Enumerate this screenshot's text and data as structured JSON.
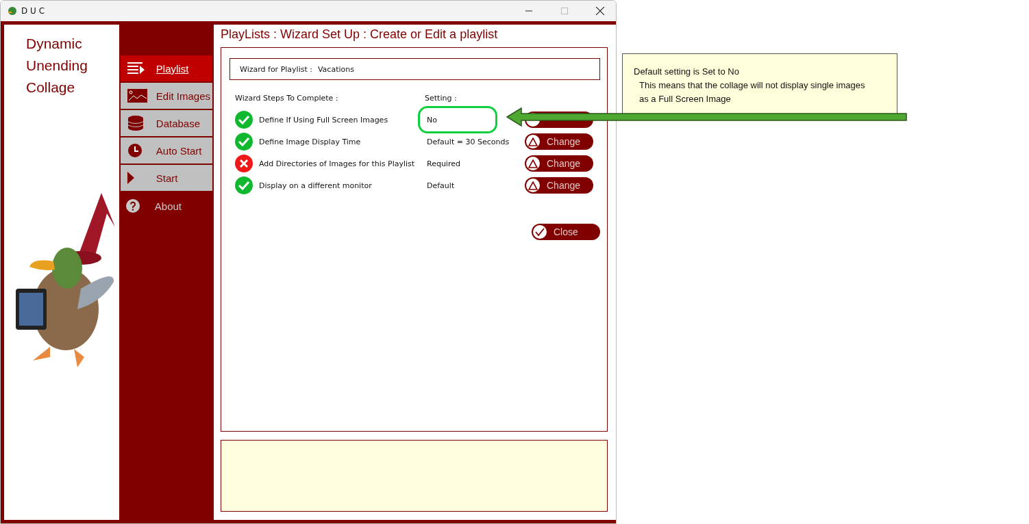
{
  "window": {
    "title": "D U C"
  },
  "brand": [
    "Dynamic",
    "Unending",
    "Collage"
  ],
  "nav": [
    {
      "label": "Playlist",
      "kind": "boxed",
      "selected": true
    },
    {
      "label": "Edit Images",
      "kind": "boxed",
      "selected": false
    },
    {
      "label": "Database",
      "kind": "boxed",
      "selected": false
    },
    {
      "label": "Auto Start",
      "kind": "boxed",
      "selected": false
    },
    {
      "label": "Start",
      "kind": "boxed",
      "selected": false
    },
    {
      "label": "About",
      "kind": "plain",
      "selected": false
    }
  ],
  "page_title": "PlayLists : Wizard Set Up : Create or Edit a playlist",
  "playlist_field": {
    "label": "Wizard for Playlist :",
    "value": "Vacations"
  },
  "steps_heading": "Wizard Steps To Complete :",
  "setting_heading": "Setting :",
  "steps": [
    {
      "label": "Define If Using Full Screen Images",
      "setting": "No",
      "done": true,
      "highlighted": true
    },
    {
      "label": "Define Image Display Time",
      "setting": "Default = 30 Seconds",
      "done": true,
      "highlighted": false,
      "button": "Change"
    },
    {
      "label": "Add Directories of Images for this Playlist",
      "setting": "Required",
      "done": false,
      "highlighted": false,
      "button": "Change"
    },
    {
      "label": "Display on a different monitor",
      "setting": "Default",
      "done": true,
      "highlighted": false,
      "button": "Change"
    }
  ],
  "close_button": "Close",
  "callout": {
    "lines": [
      "Default setting is Set to No",
      "This means that the collage will not display single images",
      "as a Full Screen Image"
    ]
  }
}
